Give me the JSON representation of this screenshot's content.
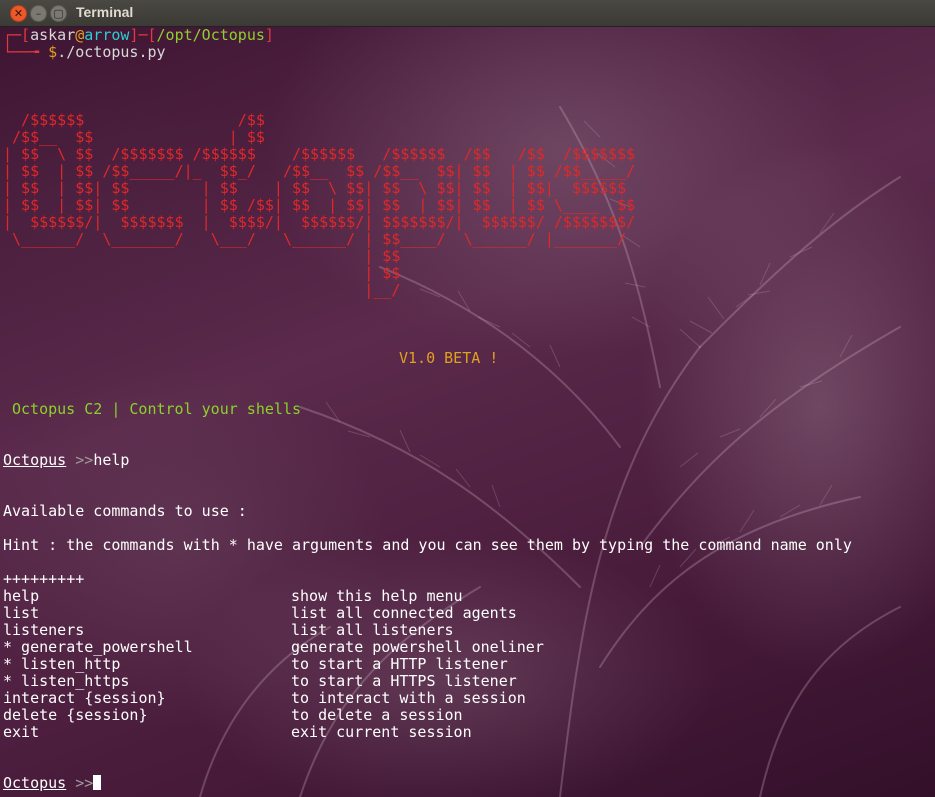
{
  "window": {
    "title": "Terminal",
    "close_glyph": "✕",
    "min_glyph": "–",
    "max_glyph": "▢"
  },
  "prompt": {
    "corner_top": "┌─[",
    "user": "askar",
    "at": "@",
    "host": "arrow",
    "sep": "]─[",
    "path": "/opt/Octopus",
    "close": "]",
    "corner_bottom": "└──╼ ",
    "symbol": "$",
    "command": "./octopus.py"
  },
  "banner": {
    "lines": [
      "  /$$$$$$                 /$$",
      " /$$__  $$               | $$",
      "| $$  \\ $$  /$$$$$$$ /$$$$$$    /$$$$$$   /$$$$$$  /$$   /$$  /$$$$$$$",
      "| $$  | $$ /$$_____/|_  $$_/   /$$__  $$ /$$__  $$| $$  | $$ /$$_____/",
      "| $$  | $$| $$        | $$    | $$  \\ $$| $$  \\ $$| $$  | $$|  $$$$$$",
      "| $$  | $$| $$        | $$ /$$| $$  | $$| $$  | $$| $$  | $$ \\____  $$",
      "|  $$$$$$/|  $$$$$$$  |  $$$$/|  $$$$$$/| $$$$$$$/|  $$$$$$/ /$$$$$$$/",
      " \\______/  \\_______/   \\___/   \\______/ | $$____/  \\______/ |_______/",
      "                                        | $$",
      "                                        | $$",
      "                                        |__/"
    ],
    "version": "V1.0 BETA !",
    "tagline": "Octopus C2 | Control your shells"
  },
  "session1": {
    "prompt_name": "Octopus",
    "prompt_arrows": ">>",
    "command": "help"
  },
  "help": {
    "heading": "Available commands to use :",
    "hint": "Hint : the commands with * have arguments and you can see them by typing the command name only",
    "divider": "+++++++++",
    "commands": [
      {
        "name": "help",
        "desc": "show this help menu"
      },
      {
        "name": "list",
        "desc": "list all connected agents"
      },
      {
        "name": "listeners",
        "desc": "list all listeners"
      },
      {
        "name": "* generate_powershell",
        "desc": "generate powershell oneliner"
      },
      {
        "name": "* listen_http",
        "desc": "to start a HTTP listener"
      },
      {
        "name": "* listen_https",
        "desc": "to start a HTTPS listener"
      },
      {
        "name": "interact {session}",
        "desc": "to interact with a session"
      },
      {
        "name": "delete {session}",
        "desc": "to delete a session"
      },
      {
        "name": "exit",
        "desc": "exit current session"
      }
    ]
  },
  "session2": {
    "prompt_name": "Octopus",
    "prompt_arrows": ">>"
  },
  "colors": {
    "titlebar": "#3b3a35",
    "terminal_bg": "#4a1c3c",
    "red": "#e03a3a",
    "cyan": "#2bd0d0",
    "green": "#8bd22a",
    "yellow": "#e0a020"
  },
  "icons": [
    "close-icon",
    "minimize-icon",
    "maximize-icon"
  ]
}
